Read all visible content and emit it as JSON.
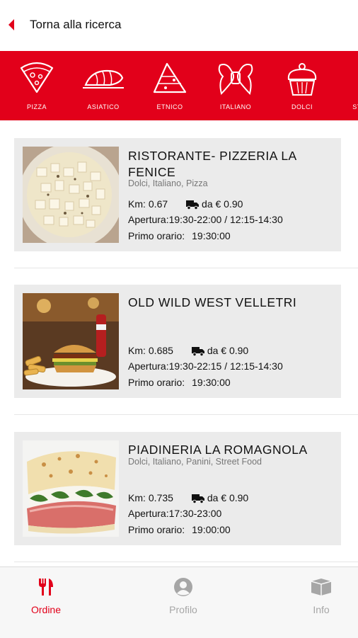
{
  "header": {
    "back_label": "Torna alla ricerca"
  },
  "categories": [
    {
      "label": "PIZZA",
      "icon": "pizza-icon"
    },
    {
      "label": "ASIATICO",
      "icon": "sushi-icon"
    },
    {
      "label": "ETNICO",
      "icon": "ethnic-icon"
    },
    {
      "label": "ITALIANO",
      "icon": "pasta-icon"
    },
    {
      "label": "DOLCI",
      "icon": "cupcake-icon"
    },
    {
      "label": "STR",
      "icon": "street-food-icon"
    }
  ],
  "restaurants": [
    {
      "name": "RISTORANTE- PIZZERIA LA FENICE",
      "categories": "Dolci, Italiano, Pizza",
      "km_label": "Km:",
      "km": "0.67",
      "delivery": "da € 0.90",
      "opening_label": "Apertura:",
      "opening": "19:30-22:00 / 12:15-14:30",
      "first_label": "Primo orario:",
      "first": "19:30:00"
    },
    {
      "name": "OLD WILD WEST VELLETRI",
      "categories": "",
      "km_label": "Km:",
      "km": "0.685",
      "delivery": "da € 0.90",
      "opening_label": "Apertura:",
      "opening": "19:30-22:15 / 12:15-14:30",
      "first_label": "Primo orario:",
      "first": "19:30:00"
    },
    {
      "name": "PIADINERIA LA ROMAGNOLA",
      "categories": "Dolci, Italiano, Panini, Street Food",
      "km_label": "Km:",
      "km": "0.735",
      "delivery": "da € 0.90",
      "opening_label": "Apertura:",
      "opening": "17:30-23:00",
      "first_label": "Primo orario:",
      "first": "19:00:00"
    }
  ],
  "tabs": [
    {
      "label": "Ordine",
      "icon": "fork-knife-icon",
      "active": true
    },
    {
      "label": "Profilo",
      "icon": "profile-icon",
      "active": false
    },
    {
      "label": "Info",
      "icon": "box-icon",
      "active": false
    }
  ],
  "colors": {
    "accent": "#e2001a",
    "card_bg": "#ebebeb",
    "inactive_tab": "#a6a6a6"
  }
}
